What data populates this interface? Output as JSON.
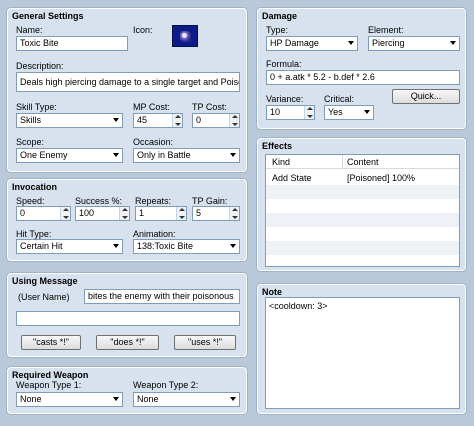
{
  "general": {
    "title": "General Settings",
    "name_label": "Name:",
    "name_value": "Toxic Bite",
    "icon_label": "Icon:",
    "description_label": "Description:",
    "description_value": "Deals high piercing damage to a single target and Poisons",
    "skill_type_label": "Skill Type:",
    "skill_type_value": "Skills",
    "mp_cost_label": "MP Cost:",
    "mp_cost_value": "45",
    "tp_cost_label": "TP Cost:",
    "tp_cost_value": "0",
    "scope_label": "Scope:",
    "scope_value": "One Enemy",
    "occasion_label": "Occasion:",
    "occasion_value": "Only in Battle"
  },
  "invocation": {
    "title": "Invocation",
    "speed_label": "Speed:",
    "speed_value": "0",
    "success_label": "Success %:",
    "success_value": "100",
    "repeats_label": "Repeats:",
    "repeats_value": "1",
    "tp_gain_label": "TP Gain:",
    "tp_gain_value": "5",
    "hit_type_label": "Hit Type:",
    "hit_type_value": "Certain Hit",
    "animation_label": "Animation:",
    "animation_value": "138:Toxic Bite"
  },
  "using_message": {
    "title": "Using Message",
    "user_name": "(User Name)",
    "message1": "bites the enemy with their poisonous",
    "message2": "",
    "btn_casts": "\"casts *!\"",
    "btn_does": "\"does *!\"",
    "btn_uses": "\"uses *!\""
  },
  "required_weapon": {
    "title": "Required Weapon",
    "type1_label": "Weapon Type 1:",
    "type1_value": "None",
    "type2_label": "Weapon Type 2:",
    "type2_value": "None"
  },
  "damage": {
    "title": "Damage",
    "type_label": "Type:",
    "type_value": "HP Damage",
    "element_label": "Element:",
    "element_value": "Piercing",
    "formula_label": "Formula:",
    "formula_value": "0 + a.atk * 5.2 - b.def * 2.6",
    "variance_label": "Variance:",
    "variance_value": "10",
    "critical_label": "Critical:",
    "critical_value": "Yes",
    "quick_label": "Quick..."
  },
  "effects": {
    "title": "Effects",
    "col_kind": "Kind",
    "col_content": "Content",
    "rows": [
      {
        "kind": "Add State",
        "content": "[Poisoned] 100%"
      }
    ]
  },
  "note": {
    "title": "Note",
    "value": "<cooldown: 3>"
  }
}
